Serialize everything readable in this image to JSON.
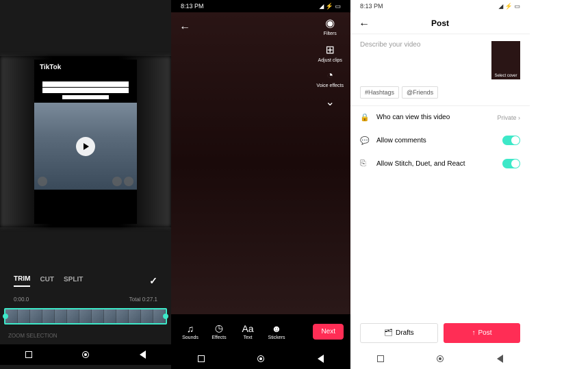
{
  "p1": {
    "brand": "TikTok",
    "tabs": {
      "trim": "TRIM",
      "cut": "CUT",
      "split": "SPLIT"
    },
    "time_start": "0:00.0",
    "time_total": "Total 0:27.1",
    "zoom": "ZOOM SELECTION"
  },
  "p2": {
    "time": "8:13 PM",
    "side": {
      "filters": "Filters",
      "adjust": "Adjust clips",
      "voice": "Voice effects"
    },
    "tools": {
      "sounds": "Sounds",
      "effects": "Effects",
      "text": "Text",
      "stickers": "Stickers"
    },
    "next": "Next"
  },
  "p3": {
    "time": "8:13 PM",
    "title": "Post",
    "desc_placeholder": "Describe your video",
    "cover": "Select cover",
    "tags": {
      "hashtags": "#Hashtags",
      "friends": "@Friends"
    },
    "rows": {
      "visibility": "Who can view this video",
      "visibility_val": "Private",
      "comments": "Allow comments",
      "stitch": "Allow Stitch, Duet, and React"
    },
    "drafts": "Drafts",
    "post": "Post"
  }
}
